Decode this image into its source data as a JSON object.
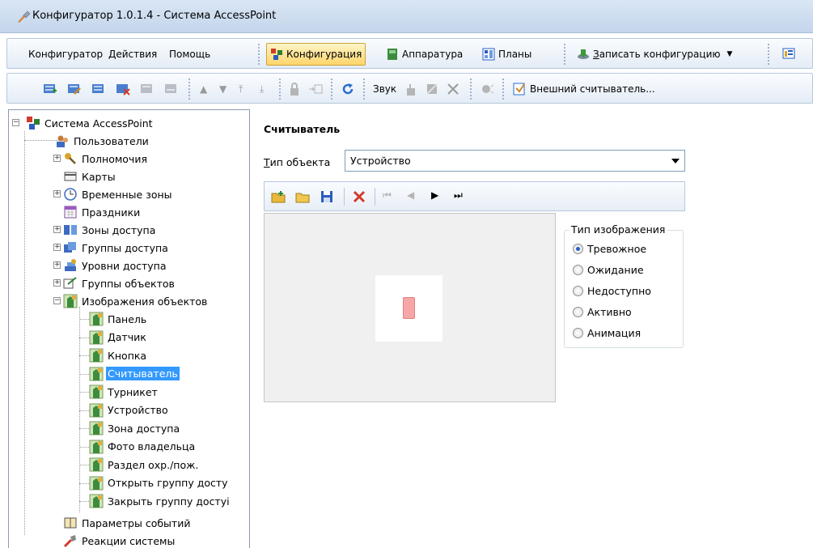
{
  "window": {
    "title": "Конфигуратор 1.0.1.4 - Система AccessPoint"
  },
  "menu": {
    "items": [
      "Конфигуратор",
      "Действия",
      "Помощь"
    ],
    "views": [
      {
        "label": "Конфигурация",
        "active": true,
        "icon": "configuration-icon"
      },
      {
        "label": "Аппаратура",
        "active": false,
        "icon": "hardware-icon"
      },
      {
        "label": "Планы",
        "active": false,
        "icon": "plans-icon"
      }
    ],
    "write_config": "Записать конфигурацию",
    "info_icon": "info-icon"
  },
  "toolbar": {
    "sound_label": "Звук",
    "external_reader_label": "Внешний считыватель..."
  },
  "tree": {
    "root": "Система AccessPoint",
    "items": [
      {
        "label": "Пользователи",
        "icon": "users-icon"
      },
      {
        "label": "Полномочия",
        "icon": "permissions-icon"
      },
      {
        "label": "Карты",
        "icon": "cards-icon"
      },
      {
        "label": "Временные зоны",
        "icon": "time-zones-icon"
      },
      {
        "label": "Праздники",
        "icon": "holidays-icon"
      },
      {
        "label": "Зоны доступа",
        "icon": "access-zones-icon"
      },
      {
        "label": "Группы доступа",
        "icon": "access-groups-icon"
      },
      {
        "label": "Уровни доступа",
        "icon": "access-levels-icon"
      },
      {
        "label": "Группы объектов",
        "icon": "object-groups-icon"
      },
      {
        "label": "Изображения объектов",
        "icon": "object-images-icon"
      }
    ],
    "image_children": [
      "Панель",
      "Датчик",
      "Кнопка",
      "Считыватель",
      "Турникет",
      "Устройство",
      "Зона доступа",
      "Фото владельца",
      "Раздел охр./пож.",
      "Открыть группу досту",
      "Закрыть группу достуі"
    ],
    "selected": "Считыватель",
    "tail": [
      {
        "label": "Параметры событий",
        "icon": "event-params-icon"
      },
      {
        "label": "Реакции системы",
        "icon": "system-reactions-icon"
      }
    ]
  },
  "content": {
    "title": "Считыватель",
    "object_type_label": "Тип объекта",
    "object_type_value": "Устройство",
    "image_type_group": "Тип изображения",
    "image_types": [
      {
        "label": "Тревожное",
        "checked": true
      },
      {
        "label": "Ожидание",
        "checked": false
      },
      {
        "label": "Недоступно",
        "checked": false
      },
      {
        "label": "Активно",
        "checked": false
      },
      {
        "label": "Анимация",
        "checked": false
      }
    ]
  },
  "colors": {
    "accent": "#3399ff",
    "active_tab": "#ffd56a",
    "reader_image": "#f6a6a6"
  }
}
